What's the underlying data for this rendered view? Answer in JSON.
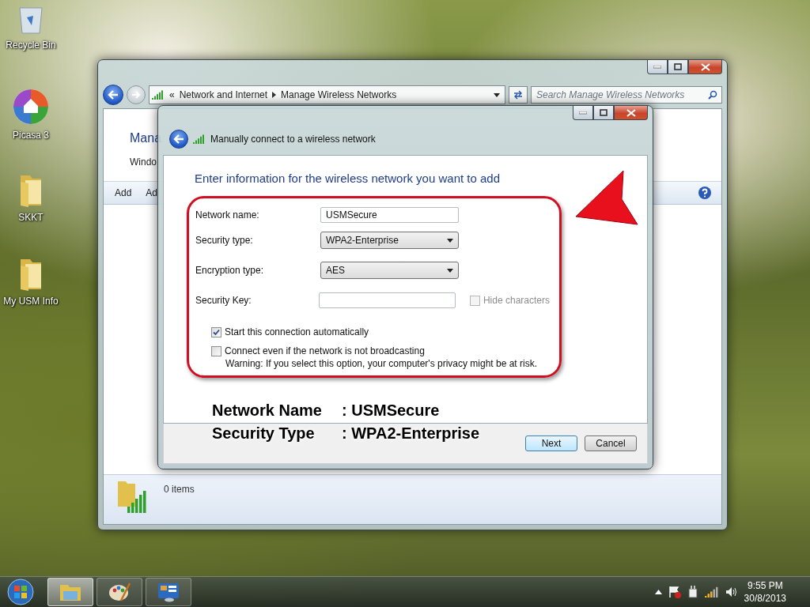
{
  "desktop": {
    "icons": [
      {
        "kind": "recycle",
        "label": "Recycle Bin"
      },
      {
        "kind": "picasa",
        "label": "Picasa 3"
      },
      {
        "kind": "folder",
        "label": "SKKT"
      },
      {
        "kind": "folder",
        "label": "My USM Info"
      }
    ]
  },
  "explorer": {
    "address": {
      "overflow": "«",
      "crumbs": [
        "Network and Internet",
        "Manage Wireless Networks"
      ]
    },
    "search": {
      "placeholder": "Search Manage Wireless Networks"
    },
    "heading": "Mana",
    "subtext": "Windo",
    "toolbar": [
      "Add",
      "Ad"
    ],
    "status": "0 items"
  },
  "dialog": {
    "title": "Manually connect to a wireless network",
    "heading": "Enter information for the wireless network you want to add",
    "fields": [
      {
        "kind": "text",
        "label": "Network name:",
        "value": "USMSecure"
      },
      {
        "kind": "select",
        "label": "Security type:",
        "value": "WPA2-Enterprise"
      },
      {
        "kind": "select",
        "label": "Encryption type:",
        "value": "AES"
      },
      {
        "kind": "key",
        "label": "Security Key:",
        "option": {
          "label": "Hide characters",
          "checked": false,
          "disabled": true
        }
      }
    ],
    "options": [
      {
        "label": "Start this connection automatically",
        "checked": true
      },
      {
        "label": "Connect even if the network is not broadcasting",
        "checked": false
      }
    ],
    "warning": "Warning: If you select this option, your computer's privacy might be at risk.",
    "buttons": [
      {
        "label": "Next",
        "default": true
      },
      {
        "label": "Cancel",
        "default": false
      }
    ]
  },
  "annotation": {
    "lines": [
      {
        "label": "Network Name",
        "value": ": USMSecure"
      },
      {
        "label": "Security Type",
        "value": ": WPA2-Enterprise"
      }
    ]
  },
  "taskbar": {
    "apps": [
      {
        "kind": "explorer",
        "selected": true
      },
      {
        "kind": "paint",
        "selected": false
      },
      {
        "kind": "control",
        "selected": false
      }
    ],
    "time": "9:55 PM",
    "date": "30/8/2013"
  }
}
